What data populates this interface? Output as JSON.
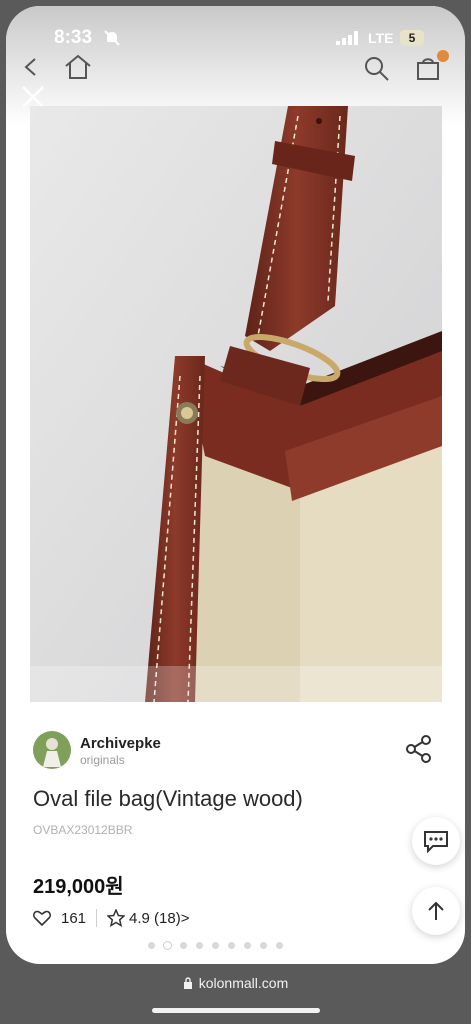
{
  "status_bar": {
    "time": "8:33",
    "network": "LTE",
    "battery": "5"
  },
  "seller": {
    "name": "Archivepke",
    "subtitle": "originals"
  },
  "product": {
    "name": "Oval file bag(Vintage wood)",
    "code": "OVBAX23012BBR",
    "price": "219,000원",
    "likes": "161",
    "rating": "4.9 (18)",
    "rating_arrow": ">"
  },
  "gallery": {
    "total_images": 9,
    "active_index": 1
  },
  "browser": {
    "url": "kolonmall.com"
  },
  "icons": {
    "back": "chevron-left-icon",
    "home": "home-icon",
    "search": "search-icon",
    "cart": "bag-icon",
    "close": "close-icon",
    "share": "share-icon",
    "chat": "chat-icon",
    "scroll_top": "arrow-up-icon",
    "lock": "lock-icon"
  },
  "colors": {
    "accent": "#e08a3a",
    "leather": "#7a2f22",
    "canvas": "#e8ddc2"
  }
}
